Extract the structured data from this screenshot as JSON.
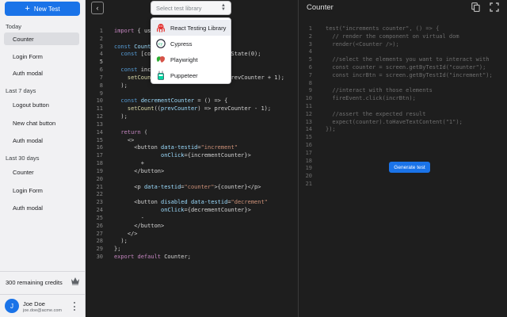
{
  "sidebar": {
    "new_test_label": "New Test",
    "sections": [
      {
        "label": "Today",
        "items": [
          "Counter",
          "Login Form",
          "Auth modal"
        ]
      },
      {
        "label": "Last 7 days",
        "items": [
          "Logout button",
          "New chat button",
          "Auth modal"
        ]
      },
      {
        "label": "Last 30 days",
        "items": [
          "Counter",
          "Login Form",
          "Auth modal"
        ]
      }
    ],
    "credits": "300 remaining credits",
    "user": {
      "initial": "J",
      "name": "Joe Doe",
      "email": "joe.doe@acme.com"
    }
  },
  "editor": {
    "library_placeholder": "Select test library",
    "library_options": [
      "React Testing Library",
      "Cypress",
      "Playwright",
      "Puppeteer"
    ],
    "line_numbers": [
      "1",
      "2",
      "3",
      "4",
      "5",
      "6",
      "7",
      "8",
      "9",
      "10",
      "11",
      "12",
      "13",
      "14",
      "15",
      "16",
      "17",
      "18",
      "19",
      "20",
      "21",
      "22",
      "23",
      "24",
      "25",
      "26",
      "27",
      "28",
      "29",
      "30"
    ]
  },
  "right_panel": {
    "title": "Counter",
    "line_numbers": [
      "1",
      "2",
      "3",
      "4",
      "5",
      "6",
      "7",
      "8",
      "9",
      "10",
      "11",
      "12",
      "13",
      "14",
      "15",
      "16",
      "17",
      "18",
      "19",
      "20",
      "21"
    ],
    "code_lines": [
      "test(\"increments counter\", () => {",
      "  // render the component on virtual dom",
      "  render(<Counter />);",
      "",
      "  //select the elements you want to interact with",
      "  const counter = screen.getByTestId(\"counter\");",
      "  const incrBtn = screen.getByTestId(\"increment\");",
      "",
      "  //interact with those elements",
      "  fireEvent.click(incrBtn);",
      "",
      "  //assert the expected result",
      "  expect(counter).toHaveTextContent(\"1\");",
      "});",
      "",
      "",
      "",
      "",
      "",
      "",
      ""
    ],
    "generate_label": "Generate test"
  },
  "colors": {
    "accent": "#1a73e8",
    "editor_bg": "#1e1e1e",
    "sidebar_bg": "#f1f1f3"
  }
}
